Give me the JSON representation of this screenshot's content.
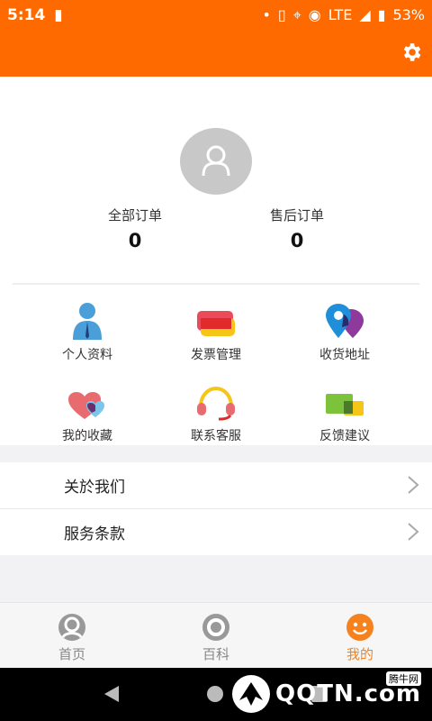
{
  "status": {
    "time": "5:14",
    "network": "LTE",
    "battery": "53%"
  },
  "orders": [
    {
      "label": "全部订单",
      "count": "0"
    },
    {
      "label": "售后订单",
      "count": "0"
    }
  ],
  "grid": [
    {
      "label": "个人资料",
      "icon": "person-icon"
    },
    {
      "label": "发票管理",
      "icon": "invoice-icon"
    },
    {
      "label": "收货地址",
      "icon": "location-icon"
    },
    {
      "label": "我的收藏",
      "icon": "heart-icon"
    },
    {
      "label": "联系客服",
      "icon": "headset-icon"
    },
    {
      "label": "反馈建议",
      "icon": "chat-icon"
    }
  ],
  "menu": [
    {
      "label": "关於我们"
    },
    {
      "label": "服务条款"
    }
  ],
  "tabs": [
    {
      "label": "首页",
      "active": false
    },
    {
      "label": "百科",
      "active": false
    },
    {
      "label": "我的",
      "active": true
    }
  ],
  "watermark": {
    "text": "QQTN.com",
    "badge": "腾牛网"
  },
  "colors": {
    "brand": "#fe6a00",
    "tab_active": "#f5821f"
  }
}
